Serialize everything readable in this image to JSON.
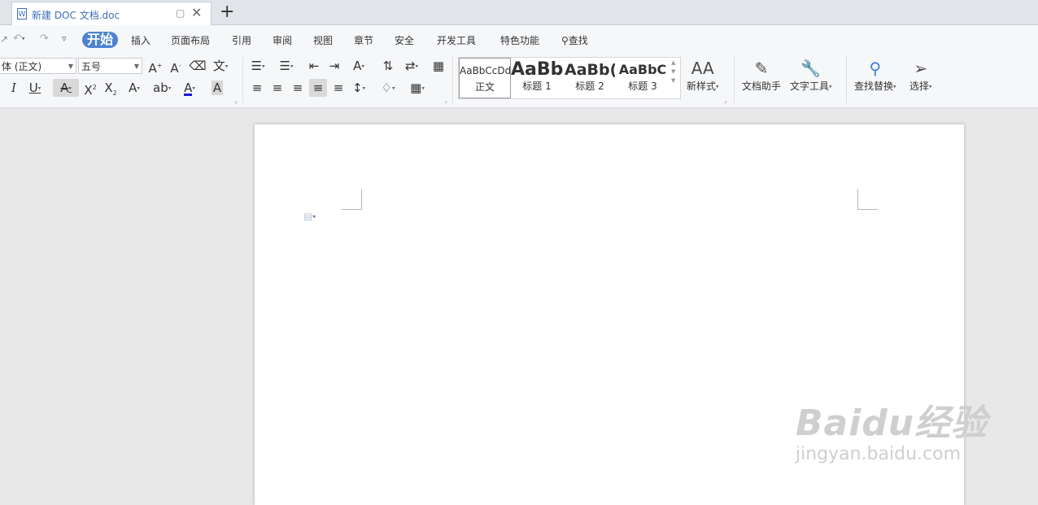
{
  "tabbar": {
    "doc_title": "新建 DOC 文档.doc",
    "new_tab": "+"
  },
  "menu": [
    "开始",
    "插入",
    "页面布局",
    "引用",
    "审阅",
    "视图",
    "章节",
    "安全",
    "开发工具",
    "特色功能",
    "查找"
  ],
  "font": {
    "name": "体 (正文)",
    "size": "五号"
  },
  "styles": [
    {
      "sample": "AaBbCcDd",
      "label": "正文"
    },
    {
      "sample": "AaBb",
      "label": "标题 1"
    },
    {
      "sample": "AaBb(",
      "label": "标题 2"
    },
    {
      "sample": "AaBbC",
      "label": "标题 3"
    }
  ],
  "tools": {
    "new_style": "新样式",
    "doc_assistant": "文档助手",
    "text_tools": "文字工具",
    "find_replace": "查找替换",
    "select": "选择"
  },
  "watermark": {
    "line1": "Baidu经验",
    "line2": "jingyan.baidu.com"
  }
}
